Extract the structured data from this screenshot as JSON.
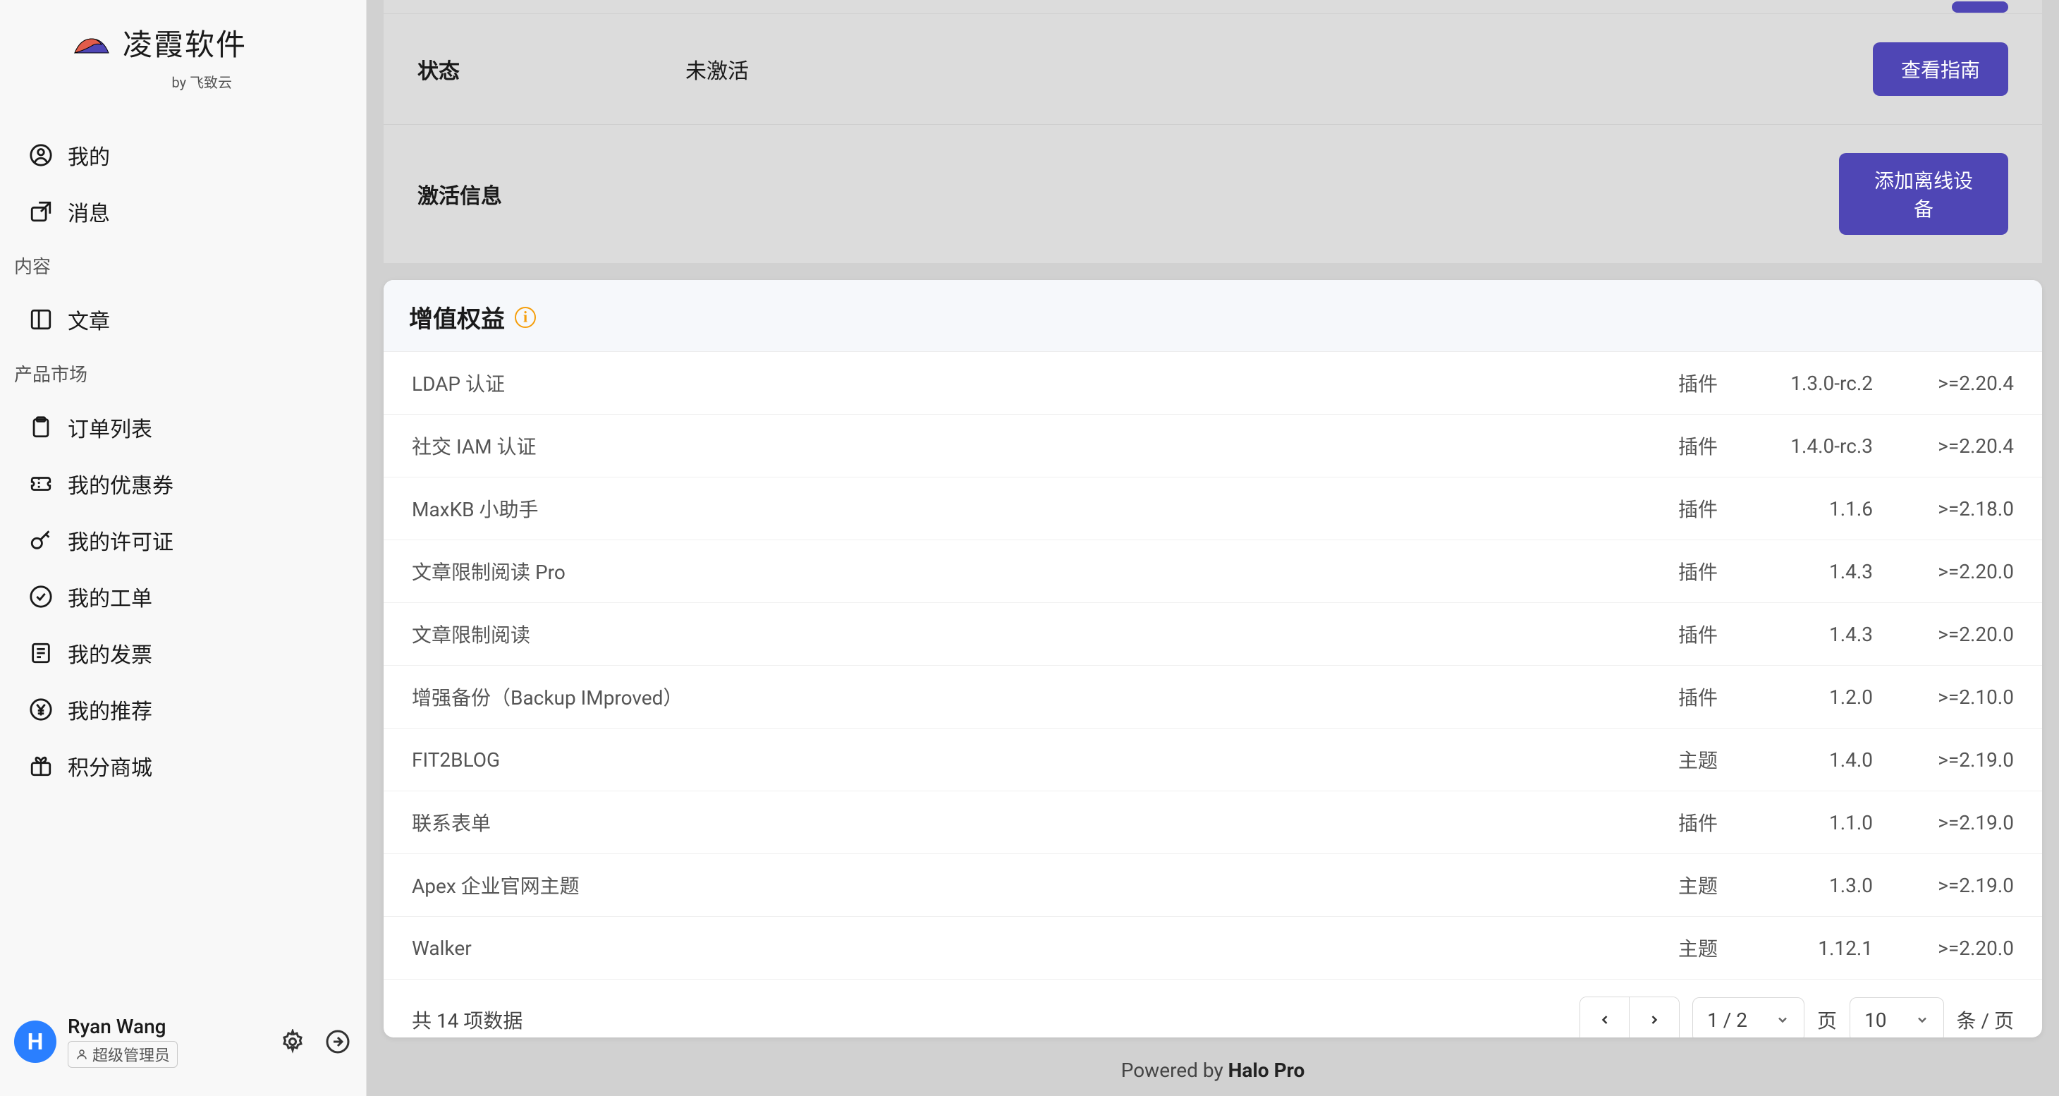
{
  "brand": {
    "name": "凌霞软件",
    "sub": "by 飞致云"
  },
  "sidebar": {
    "items": [
      {
        "label": "我的"
      },
      {
        "label": "消息"
      }
    ],
    "section_content": "内容",
    "content_items": [
      {
        "label": "文章"
      }
    ],
    "section_market": "产品市场",
    "market_items": [
      {
        "label": "订单列表"
      },
      {
        "label": "我的优惠券"
      },
      {
        "label": "我的许可证"
      },
      {
        "label": "我的工单"
      },
      {
        "label": "我的发票"
      },
      {
        "label": "我的推荐"
      },
      {
        "label": "积分商城"
      }
    ]
  },
  "user": {
    "name": "Ryan Wang",
    "role": "超级管理员",
    "avatar_letter": "H"
  },
  "info": {
    "row1": {
      "label": "状态",
      "value": "未激活",
      "button": "查看指南"
    },
    "row2": {
      "label": "激活信息",
      "value": "",
      "button": "添加离线设备"
    }
  },
  "card": {
    "title": "增值权益"
  },
  "rows": [
    {
      "name": "LDAP 认证",
      "type": "插件",
      "ver": "1.3.0-rc.2",
      "req": ">=2.20.4"
    },
    {
      "name": "社交 IAM 认证",
      "type": "插件",
      "ver": "1.4.0-rc.3",
      "req": ">=2.20.4"
    },
    {
      "name": "MaxKB 小助手",
      "type": "插件",
      "ver": "1.1.6",
      "req": ">=2.18.0"
    },
    {
      "name": "文章限制阅读 Pro",
      "type": "插件",
      "ver": "1.4.3",
      "req": ">=2.20.0"
    },
    {
      "name": "文章限制阅读",
      "type": "插件",
      "ver": "1.4.3",
      "req": ">=2.20.0"
    },
    {
      "name": "增强备份（Backup IMproved）",
      "type": "插件",
      "ver": "1.2.0",
      "req": ">=2.10.0"
    },
    {
      "name": "FIT2BLOG",
      "type": "主题",
      "ver": "1.4.0",
      "req": ">=2.19.0"
    },
    {
      "name": "联系表单",
      "type": "插件",
      "ver": "1.1.0",
      "req": ">=2.19.0"
    },
    {
      "name": "Apex 企业官网主题",
      "type": "主题",
      "ver": "1.3.0",
      "req": ">=2.19.0"
    },
    {
      "name": "Walker",
      "type": "主题",
      "ver": "1.12.1",
      "req": ">=2.20.0"
    }
  ],
  "pagination": {
    "total_text": "共 14 项数据",
    "page_display": "1 / 2",
    "page_label": "页",
    "size": "10",
    "size_suffix": "条 / 页"
  },
  "footer": {
    "powered_prefix": "Powered by ",
    "powered_name": "Halo Pro"
  }
}
